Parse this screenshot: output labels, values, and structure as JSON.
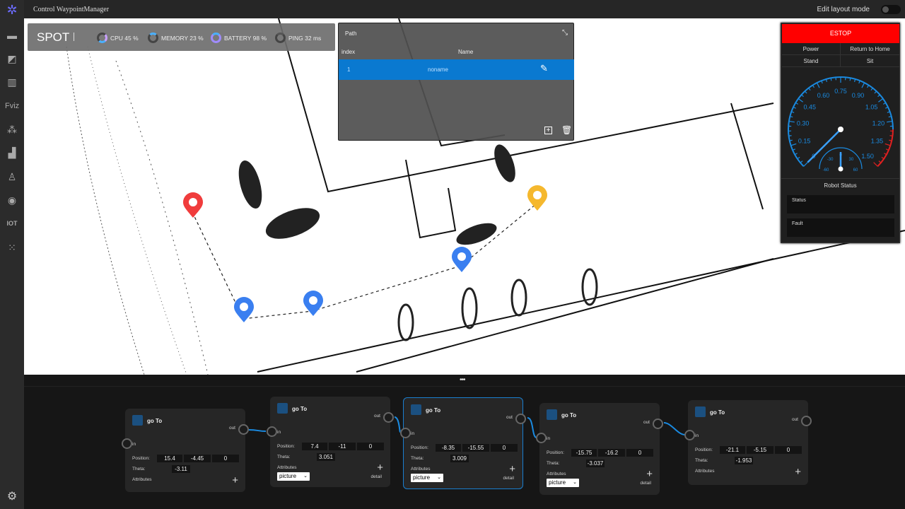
{
  "app": {
    "title": "Control WaypointManager",
    "edit_layout_label": "Edit layout mode"
  },
  "sidebar": [
    "monitor-icon",
    "map-pin-icon",
    "map-icon",
    "fviz-icon",
    "hierarchy-icon",
    "chart-icon",
    "robot-icon",
    "camera-icon",
    "iot-icon",
    "grid-icon",
    "settings-icon"
  ],
  "fviz_label": "Fviz",
  "iot_label": "IOT",
  "status": {
    "robot": "SPOT",
    "sep": "|",
    "cpu": "CPU  45 %",
    "memory": "MEMORY  23 %",
    "battery": "BATTERY  98 %",
    "ping": "PING  32 ms",
    "cpu_pct": 45,
    "memory_pct": 23,
    "battery_pct": 98
  },
  "path_panel": {
    "title": "Path",
    "col_index": "index",
    "col_name": "Name",
    "rows": [
      {
        "index": "1",
        "name": "noname"
      }
    ]
  },
  "control": {
    "estop": "ESTOP",
    "power": "Power",
    "return_home": "Return to Home",
    "stand": "Stand",
    "sit": "Sit",
    "robot_status": "Robot Status",
    "status_label": "Status",
    "fault_label": "Fault",
    "gauge_ticks": [
      "0",
      "0.15",
      "0.30",
      "0.45",
      "0.60",
      "0.75",
      "0.90",
      "1.05",
      "1.20",
      "1.35",
      "1.50"
    ],
    "gauge_value": 0,
    "small_ticks": [
      "-60",
      "-30",
      "0",
      "30",
      "60"
    ],
    "small_value": 0
  },
  "colors": {
    "accent": "#0a79d0",
    "estop": "#ff0000",
    "marker_red": "#f03c3c",
    "marker_blue": "#3a7ff0",
    "marker_yellow": "#f5b82e"
  },
  "nodes": [
    {
      "title": "go To",
      "in": "in",
      "out": "out",
      "position_label": "Position:",
      "pos": [
        "15.4",
        "-4.45",
        "0"
      ],
      "theta_label": "Theta:",
      "theta": "-3.11",
      "attributes_label": "Attributes"
    },
    {
      "title": "go To",
      "in": "in",
      "out": "out",
      "position_label": "Position:",
      "pos": [
        "7.4",
        "-11",
        "0"
      ],
      "theta_label": "Theta:",
      "theta": "3.051",
      "attributes_label": "Attributes",
      "select": "picture",
      "detail": "detail"
    },
    {
      "title": "go To",
      "in": "in",
      "out": "out",
      "position_label": "Position:",
      "pos": [
        "-8.35",
        "-15.55",
        "0"
      ],
      "theta_label": "Theta:",
      "theta": "3.009",
      "attributes_label": "Attributes",
      "select": "picture",
      "detail": "detail"
    },
    {
      "title": "go To",
      "in": "in",
      "out": "out",
      "position_label": "Position:",
      "pos": [
        "-15.75",
        "-16.2",
        "0"
      ],
      "theta_label": "Theta:",
      "theta": "-3.037",
      "attributes_label": "Attributes",
      "select": "picture",
      "detail": "detail"
    },
    {
      "title": "go To",
      "in": "in",
      "out": "out",
      "position_label": "Position:",
      "pos": [
        "-21.1",
        "-5.15",
        "0"
      ],
      "theta_label": "Theta:",
      "theta": "-1.953",
      "attributes_label": "Attributes"
    }
  ],
  "bottom": {
    "handle": "•••"
  }
}
